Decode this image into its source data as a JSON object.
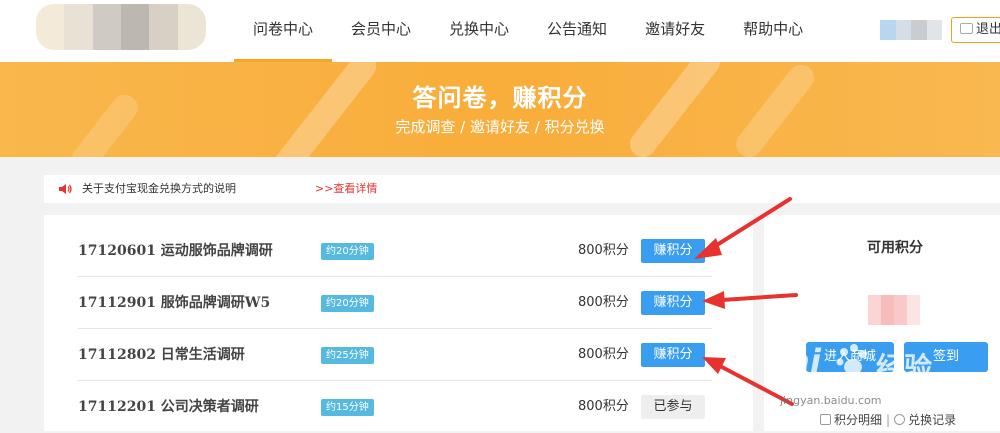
{
  "nav": {
    "items": [
      "问卷中心",
      "会员中心",
      "兑换中心",
      "公告通知",
      "邀请好友",
      "帮助中心"
    ],
    "logout_label": "退出"
  },
  "banner": {
    "title": "答问卷，赚积分",
    "subtitle": "完成调查 / 邀请好友 / 积分兑换"
  },
  "notice": {
    "text": "关于支付宝现金兑换方式的说明",
    "link": ">>查看详情"
  },
  "surveys": [
    {
      "title": "17120601 运动服饰品牌调研",
      "duration": "约20分钟",
      "points": "800积分",
      "action": "赚积分"
    },
    {
      "title": "17112901 服饰品牌调研W5",
      "duration": "约20分钟",
      "points": "800积分",
      "action": "赚积分"
    },
    {
      "title": "17112802 日常生活调研",
      "duration": "约25分钟",
      "points": "800积分",
      "action": "赚积分"
    },
    {
      "title": "17112201 公司决策者调研",
      "duration": "约15分钟",
      "points": "800积分",
      "action": "已参与"
    }
  ],
  "sidebar": {
    "title": "可用积分",
    "enter_label": "进入商城",
    "checkin_label": "签到",
    "points_detail": "积分明细",
    "exchange_record": "兑换记录"
  },
  "watermark": {
    "brand": "Bai",
    "brand_cn": "经验",
    "site": "jingyan.baidu.com"
  },
  "colors": {
    "accent": "#f5a623",
    "button": "#3a9ef0",
    "duration_tag": "#56b9e0",
    "notice_link": "#e8322f",
    "annotation_arrow": "#e8322f"
  }
}
